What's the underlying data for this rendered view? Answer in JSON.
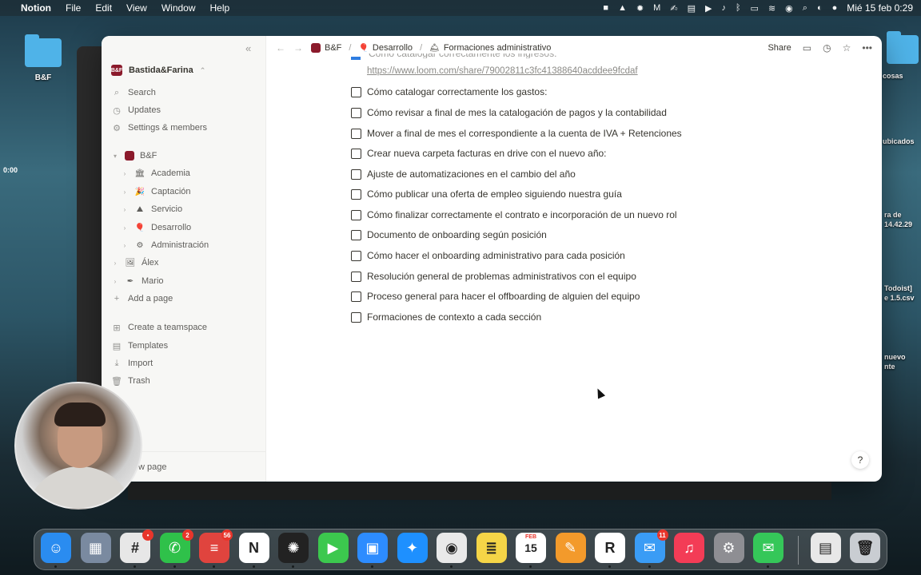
{
  "menubar": {
    "app_name": "Notion",
    "items": [
      "File",
      "Edit",
      "View",
      "Window",
      "Help"
    ],
    "clock": "Mié 15 feb 0:29"
  },
  "desktop": {
    "folder_label": "B&F",
    "right_fragments": [
      "cosas",
      "ubicados",
      "ra de",
      "14.42.29",
      "Todoist]",
      "e 1.5.csv",
      "nuevo",
      "nte"
    ],
    "timer": "0:00"
  },
  "sidebar": {
    "workspace_name": "Bastida&Farina",
    "workspace_logo": "B&F",
    "top_items": [
      {
        "label": "Search",
        "icon": "search-icon"
      },
      {
        "label": "Updates",
        "icon": "clock-icon"
      },
      {
        "label": "Settings & members",
        "icon": "gear-icon"
      }
    ],
    "tree_root": "B&F",
    "tree_children": [
      {
        "label": "Academia",
        "emoji": "🏛"
      },
      {
        "label": "Captación",
        "emoji": "🎉"
      },
      {
        "label": "Servicio",
        "emoji": "⛰"
      },
      {
        "label": "Desarrollo",
        "emoji": "🎈"
      },
      {
        "label": "Administración",
        "emoji": "⚙"
      }
    ],
    "people": [
      {
        "label": "Álex",
        "emoji": "🖼"
      },
      {
        "label": "Mario",
        "emoji": "✒"
      }
    ],
    "add_page": "Add a page",
    "bottom_items": [
      {
        "label": "Create a teamspace",
        "icon": "teamspace-icon"
      },
      {
        "label": "Templates",
        "icon": "templates-icon"
      },
      {
        "label": "Import",
        "icon": "import-icon"
      },
      {
        "label": "Trash",
        "icon": "trash-icon"
      }
    ],
    "new_page": "w page"
  },
  "topbar": {
    "breadcrumb": [
      "B&F",
      "Desarrollo",
      "Formaciones administrativo"
    ],
    "share": "Share"
  },
  "content": {
    "partial_line": "Cómo catalogar correctamente los ingresos:",
    "link": "https://www.loom.com/share/79002811c3fc41388640acddee9fcdaf",
    "todos": [
      "Cómo catalogar correctamente los gastos:",
      "Cómo revisar a final de mes la catalogación de pagos y la contabilidad",
      "Mover a final de mes el correspondiente a la cuenta de IVA + Retenciones",
      "Crear nueva carpeta facturas en drive con el nuevo año:",
      "Ajuste de automatizaciones en el cambio del año",
      "Cómo publicar una oferta de empleo siguiendo nuestra guía",
      "Cómo finalizar correctamente el contrato e incorporación de un nuevo rol",
      "Documento de onboarding según posición",
      "Cómo hacer el onboarding administrativo para cada posición",
      "Resolución general de problemas administrativos con el equipo",
      "Proceso general para hacer el offboarding de alguien del equipo",
      "Formaciones de contexto a cada sección"
    ],
    "help": "?"
  },
  "dock": {
    "apps": [
      {
        "name": "finder",
        "glyph": "☺",
        "color": "#2a8cf0"
      },
      {
        "name": "launchpad",
        "glyph": "▦",
        "color": "#7a8aa0"
      },
      {
        "name": "slack",
        "glyph": "#",
        "color": "#e7e7e7",
        "badge": "•"
      },
      {
        "name": "whatsapp",
        "glyph": "✆",
        "color": "#2fc14a",
        "badge": "2"
      },
      {
        "name": "todoist",
        "glyph": "≡",
        "color": "#e0443e",
        "badge": "56"
      },
      {
        "name": "notion",
        "glyph": "N",
        "color": "#ffffff"
      },
      {
        "name": "chatgpt",
        "glyph": "✺",
        "color": "#222222"
      },
      {
        "name": "facetime",
        "glyph": "▶",
        "color": "#3cc84e"
      },
      {
        "name": "zoom",
        "glyph": "▣",
        "color": "#2d8cff"
      },
      {
        "name": "safari",
        "glyph": "✦",
        "color": "#1e90ff"
      },
      {
        "name": "chrome",
        "glyph": "◉",
        "color": "#e9e9e9"
      },
      {
        "name": "notes",
        "glyph": "≣",
        "color": "#f5d547"
      },
      {
        "name": "calendar",
        "glyph": "15",
        "color": "#ffffff"
      },
      {
        "name": "pages",
        "glyph": "✎",
        "color": "#f39a2b"
      },
      {
        "name": "r-app",
        "glyph": "R",
        "color": "#ffffff"
      },
      {
        "name": "mail",
        "glyph": "✉",
        "color": "#3a9cf5",
        "badge": "11"
      },
      {
        "name": "music",
        "glyph": "♫",
        "color": "#f33c56"
      },
      {
        "name": "system-settings",
        "glyph": "⚙",
        "color": "#8e8e93"
      },
      {
        "name": "messages",
        "glyph": "✉",
        "color": "#35c759"
      },
      {
        "name": "document",
        "glyph": "▤",
        "color": "#e8e8e8"
      },
      {
        "name": "trash",
        "glyph": "🗑",
        "color": "#c9cdd2"
      }
    ],
    "calendar_month": "FEB"
  }
}
